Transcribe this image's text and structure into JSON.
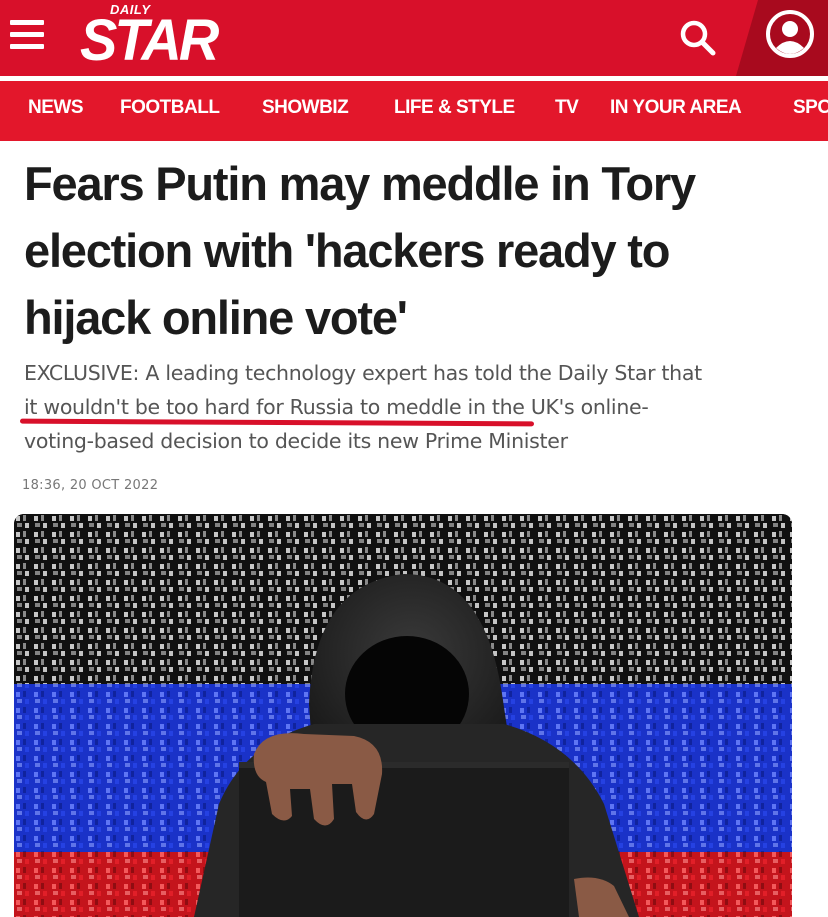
{
  "header": {
    "logo_small": "DAILY",
    "logo_main": "STAR",
    "menu_icon": "hamburger-menu-icon",
    "search_icon": "search-icon",
    "account_icon": "user-account-icon",
    "brand_color": "#d8102a"
  },
  "nav": {
    "items": [
      {
        "label": "NEWS"
      },
      {
        "label": "FOOTBALL"
      },
      {
        "label": "SHOWBIZ"
      },
      {
        "label": "LIFE & STYLE"
      },
      {
        "label": "TV"
      },
      {
        "label": "IN YOUR AREA"
      },
      {
        "label": "SPO"
      }
    ]
  },
  "article": {
    "headline_lines": [
      "Fears Putin may meddle in Tory",
      "election with 'hackers ready to",
      "hijack online vote'"
    ],
    "standfirst_lines": [
      "EXCLUSIVE: A leading technology expert has told the Daily Star that",
      "it wouldn't be too hard for Russia to meddle in the UK's online-",
      "voting-based decision to decide its new Prime Minister"
    ],
    "timestamp": "18:36, 20 OCT 2022"
  }
}
